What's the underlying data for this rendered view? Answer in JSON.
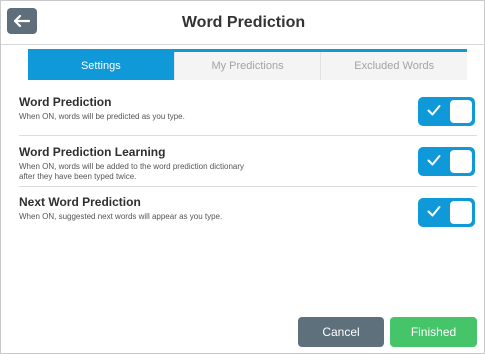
{
  "header": {
    "title": "Word Prediction",
    "back_icon": "left-arrow-icon"
  },
  "tabs": [
    {
      "label": "Settings",
      "active": true
    },
    {
      "label": "My Predictions",
      "active": false
    },
    {
      "label": "Excluded Words",
      "active": false
    }
  ],
  "settings": [
    {
      "name": "Word Prediction",
      "description": "When ON, words will be predicted as you type.",
      "enabled": true
    },
    {
      "name": "Word Prediction Learning",
      "description": "When ON, words will be added to the word prediction dictionary after they have been typed twice.",
      "enabled": true
    },
    {
      "name": "Next Word Prediction",
      "description": "When ON, suggested next words will appear as you type.",
      "enabled": true
    }
  ],
  "footer": {
    "cancel_label": "Cancel",
    "finished_label": "Finished"
  },
  "colors": {
    "accent": "#0f99d8",
    "finished": "#46c46a",
    "cancel": "#5f707d"
  }
}
